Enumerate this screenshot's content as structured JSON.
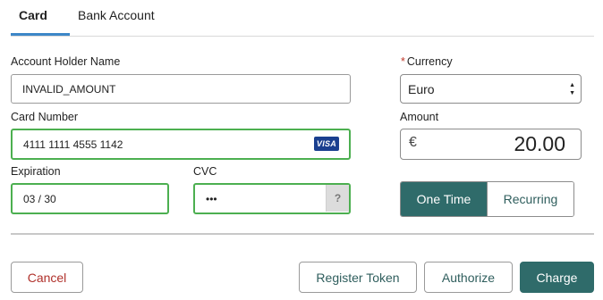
{
  "tabs": {
    "card": "Card",
    "bank_account": "Bank Account"
  },
  "form": {
    "account_holder": {
      "label": "Account Holder Name",
      "value": "INVALID_AMOUNT"
    },
    "card_number": {
      "label": "Card Number",
      "value": "4111 1111 4555 1142",
      "brand": "VISA"
    },
    "expiration": {
      "label": "Expiration",
      "value": "03 / 30"
    },
    "cvc": {
      "label": "CVC",
      "value": "•••",
      "help": "?"
    },
    "currency": {
      "required_mark": "*",
      "label": "Currency",
      "selected": "Euro"
    },
    "amount": {
      "label": "Amount",
      "symbol": "€",
      "value": "20.00"
    },
    "payment_type": {
      "options": [
        "One Time",
        "Recurring"
      ],
      "selected": "One Time"
    }
  },
  "actions": {
    "cancel": "Cancel",
    "register_token": "Register Token",
    "authorize": "Authorize",
    "charge": "Charge"
  },
  "colors": {
    "primary": "#2f6b6a",
    "tab_accent": "#3d87c8",
    "valid_border": "#4caf50",
    "danger": "#b0312b"
  }
}
